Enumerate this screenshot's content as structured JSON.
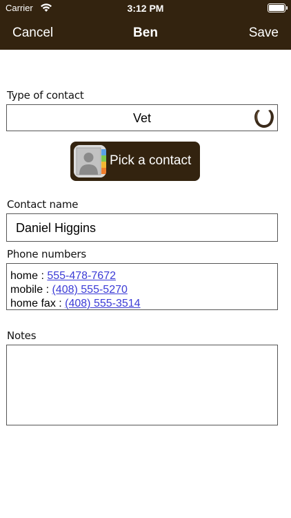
{
  "status_bar": {
    "carrier": "Carrier",
    "time": "3:12 PM",
    "icons": [
      "wifi-icon",
      "battery-icon"
    ]
  },
  "nav": {
    "cancel_label": "Cancel",
    "title": "Ben",
    "save_label": "Save",
    "bar_color": "#33230f"
  },
  "form": {
    "type_label": "Type of contact",
    "type_value": "Vet",
    "type_icon": "horseshoe-icon",
    "pick_contact_label": "Pick a contact",
    "pick_contact_icon": "contacts-app-icon",
    "contact_name_label": "Contact name",
    "contact_name_value": "Daniel Higgins",
    "phone_numbers_label": "Phone numbers",
    "phones": [
      {
        "label": "home : ",
        "number": "555-478-7672"
      },
      {
        "label": "mobile : ",
        "number": "(408) 555-5270"
      },
      {
        "label": "home fax : ",
        "number": "(408) 555-3514"
      }
    ],
    "notes_label": "Notes",
    "notes_value": ""
  },
  "colors": {
    "link": "#3b3bd6",
    "border": "#555555"
  }
}
